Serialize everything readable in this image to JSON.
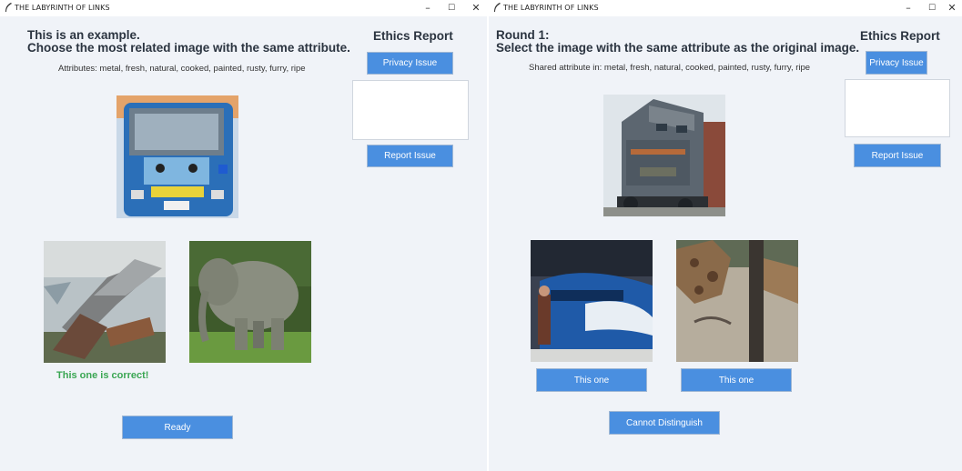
{
  "left_window": {
    "title": "THE LABYRINTH OF LINKS",
    "controls": {
      "minimize": "–",
      "maximize": "☐",
      "close": "✕"
    },
    "heading_line1": "This is an example.",
    "heading_line2": "Choose the most related image with the same attribute.",
    "attributes_text": "Attributes: metal, fresh, natural, cooked, painted, rusty, furry, ripe",
    "ethics_title": "Ethics Report",
    "privacy_button": "Privacy Issue",
    "report_button": "Report Issue",
    "correct_text": "This one is correct!",
    "ready_button": "Ready",
    "images": {
      "original": "bus-photo",
      "option1": "wrecked-train-photo",
      "option2": "elephant-photo"
    }
  },
  "right_window": {
    "title": "THE LABYRINTH OF LINKS",
    "controls": {
      "minimize": "–",
      "maximize": "☐",
      "close": "✕"
    },
    "heading_line1": "Round 1:",
    "heading_line2": "Select the image with the same attribute as the original image.",
    "attributes_text": "Shared attribute in: metal, fresh, natural, cooked, painted, rusty, furry, ripe",
    "ethics_title": "Ethics Report",
    "privacy_button": "Privacy Issue",
    "report_button": "Report Issue",
    "choice_button_1": "This one",
    "choice_button_2": "This one",
    "cannot_button": "Cannot Distinguish",
    "images": {
      "original": "locomotive-photo",
      "option1": "bullet-train-photo",
      "option2": "giraffe-photo"
    }
  },
  "colors": {
    "background": "#f0f3f8",
    "button": "#4a8fe0",
    "heading": "#2b3440",
    "correct": "#3aa653"
  }
}
